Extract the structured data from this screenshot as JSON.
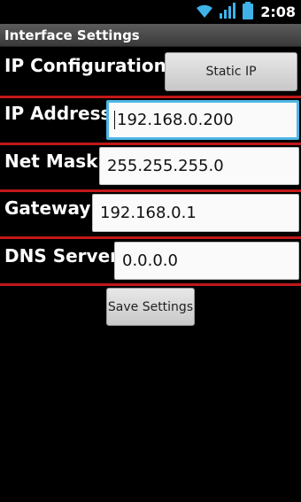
{
  "status_bar": {
    "clock": "2:08",
    "icons": [
      "wifi-icon",
      "signal-icon",
      "battery-icon"
    ]
  },
  "title_bar": {
    "title": "Interface Settings"
  },
  "rows": {
    "ip_config": {
      "label": "IP Configuration:",
      "button_label": "Static IP"
    },
    "ip_address": {
      "label": "IP Address:",
      "value": "192.168.0.200"
    },
    "net_mask": {
      "label": "Net Mask:",
      "value": "255.255.255.0"
    },
    "gateway": {
      "label": "Gateway:",
      "value": "192.168.0.1"
    },
    "dns_server": {
      "label": "DNS Server:",
      "value": "0.0.0.0"
    }
  },
  "save_button": {
    "label": "Save Settings"
  },
  "colors": {
    "divider": "#c21818",
    "focus": "#4fb5e6",
    "background": "#000000"
  }
}
